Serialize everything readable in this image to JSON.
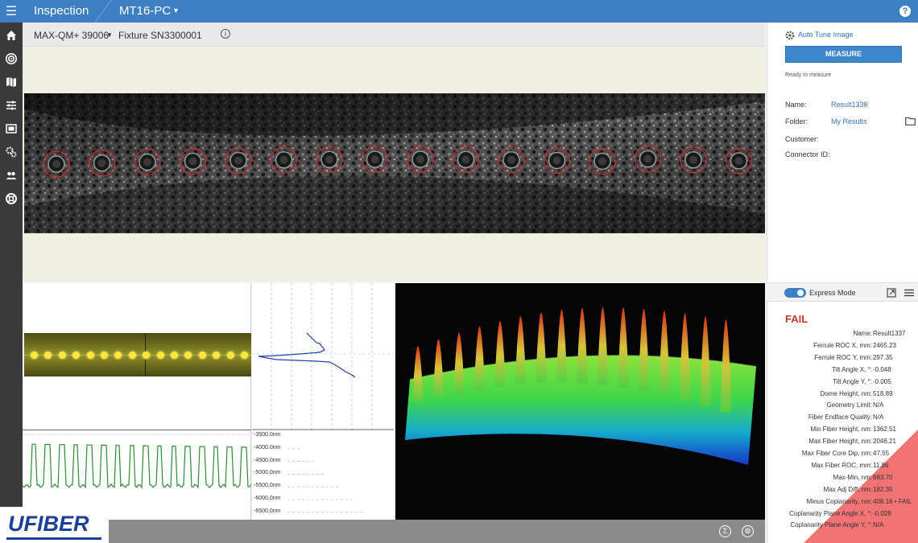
{
  "topbar": {
    "app_title": "Inspection",
    "device": "MT16-PC",
    "help_label": "?"
  },
  "subheader": {
    "model": "MAX-QM+ 39006",
    "fixture_label": "Fixture SN",
    "fixture_value": "3300001",
    "info_label": "i"
  },
  "rail": {
    "items": [
      "home-icon",
      "target-icon",
      "map-icon",
      "sliders-icon",
      "gallery-icon",
      "settings-icon",
      "users-icon",
      "help-ring-icon"
    ]
  },
  "sidebar": {
    "auto_tune": "Auto Tune Image",
    "measure": "MEASURE",
    "status": "Ready to measure",
    "fields": [
      {
        "label": "Name:",
        "value": "Result1338"
      },
      {
        "label": "Folder:",
        "value": "My Results"
      },
      {
        "label": "Customer:",
        "value": ""
      },
      {
        "label": "Connector ID:",
        "value": ""
      }
    ],
    "express_mode": "Express Mode"
  },
  "results": {
    "status": "FAIL",
    "rows": [
      {
        "label": "Name:",
        "value": "Result1337"
      },
      {
        "label": "Ferrule ROC X, mm:",
        "value": "2465.23"
      },
      {
        "label": "Ferrule ROC Y, mm:",
        "value": "297.35"
      },
      {
        "label": "Tilt Angle X, °:",
        "value": "-0.048"
      },
      {
        "label": "Tilt Angle Y, °:",
        "value": "-0.005"
      },
      {
        "label": "Dome Height, nm:",
        "value": "518.89"
      },
      {
        "label": "Geometry Limit:",
        "value": "N/A"
      },
      {
        "label": "Fiber Endface Quality:",
        "value": "N/A"
      },
      {
        "label": "Min Fiber Height, nm:",
        "value": "1362.51"
      },
      {
        "label": "Max Fiber Height, nm:",
        "value": "2046.21"
      },
      {
        "label": "Max Fiber Core Dip, nm:",
        "value": "47.55"
      },
      {
        "label": "Max Fiber ROC, mm:",
        "value": "11.86"
      },
      {
        "label": "Max-Min, nm:",
        "value": "683.70"
      },
      {
        "label": "Max Adj Diff, nm:",
        "value": "182.35"
      },
      {
        "label": "Minus Coplanarity, nm:",
        "value": "408.16 • FAIL"
      },
      {
        "label": "Coplanarity Plane Angle X, °:",
        "value": "-0.028"
      },
      {
        "label": "Coplanarity Plane Angle Y, °:",
        "value": "N/A"
      }
    ]
  },
  "profile": {
    "y_ticks": [
      "-3500.0nm",
      "-4000.0nm",
      "-4500.0nm",
      "-5000.0nm",
      "-5500.0nm",
      "-6000.0nm",
      "-6500.0nm"
    ]
  },
  "bottombar": {
    "sum_label": "Σ",
    "gear_label": "⚙"
  },
  "logo": {
    "text": "UFIBER"
  },
  "colors": {
    "accent": "#3d7fc3",
    "fail": "#c0392b",
    "rail": "#3a3a3a",
    "profile_line": "#2e8b2e",
    "vertical_profile": "#1f3fb0"
  }
}
